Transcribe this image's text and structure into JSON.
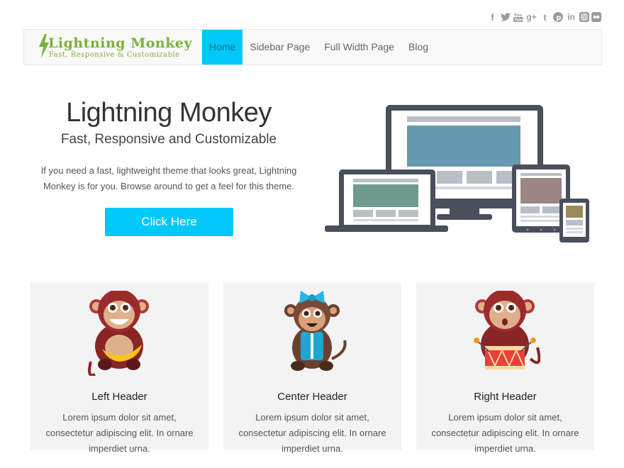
{
  "social": {
    "icons": [
      "facebook-icon",
      "twitter-icon",
      "youtube-icon",
      "google-plus-icon",
      "tumblr-icon",
      "pinterest-icon",
      "linkedin-icon",
      "instagram-icon",
      "flickr-icon"
    ],
    "color": "#9a9a9a"
  },
  "logo": {
    "title": "Lightning Monkey",
    "tagline": "Fast, Responsive & Customizable",
    "color": "#7db03a"
  },
  "nav": {
    "items": [
      {
        "label": "Home",
        "active": true
      },
      {
        "label": "Sidebar Page",
        "active": false
      },
      {
        "label": "Full Width Page",
        "active": false
      },
      {
        "label": "Blog",
        "active": false
      }
    ],
    "accent": "#00c8f8"
  },
  "hero": {
    "title": "Lightning Monkey",
    "subtitle": "Fast, Responsive and Customizable",
    "text": "If you need a fast, lightweight theme that looks great, Lightning Monkey is for you. Browse around to get a feel for this theme.",
    "button_label": "Click Here"
  },
  "cards": [
    {
      "header": "Left Header",
      "text": "Lorem ipsum dolor sit amet, consectetur adipiscing elit. In ornare imperdiet urna.",
      "art": "monkey-banana-icon"
    },
    {
      "header": "Center Header",
      "text": "Lorem ipsum dolor sit amet, consectetur adipiscing elit. In ornare imperdiet urna.",
      "art": "monkey-bow-icon"
    },
    {
      "header": "Right Header",
      "text": "Lorem ipsum dolor sit amet, consectetur adipiscing elit. In ornare imperdiet urna.",
      "art": "monkey-drum-icon"
    }
  ]
}
